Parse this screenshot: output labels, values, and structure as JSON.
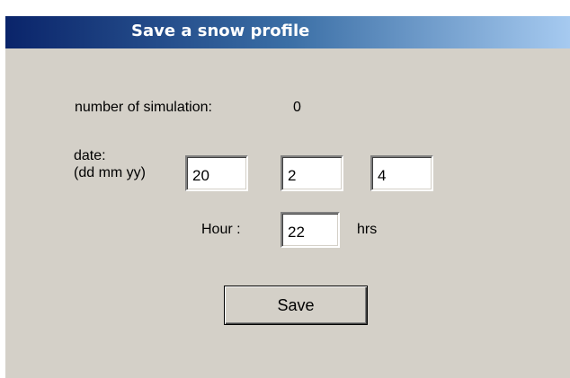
{
  "window": {
    "title": "Save a snow profile"
  },
  "form": {
    "simulation_label": "number of simulation:",
    "simulation_value": "0",
    "date_label_line1": "date:",
    "date_label_line2": "(dd mm yy)",
    "day_value": "20",
    "month_value": "2",
    "year_value": "4",
    "hour_label": "Hour :",
    "hour_value": "22",
    "hour_unit": "hrs",
    "save_label": "Save"
  },
  "colors": {
    "window_background": "#d4d0c8",
    "titlebar_start": "#0a246a",
    "titlebar_end": "#a6caf0",
    "title_text": "#ffffff"
  }
}
